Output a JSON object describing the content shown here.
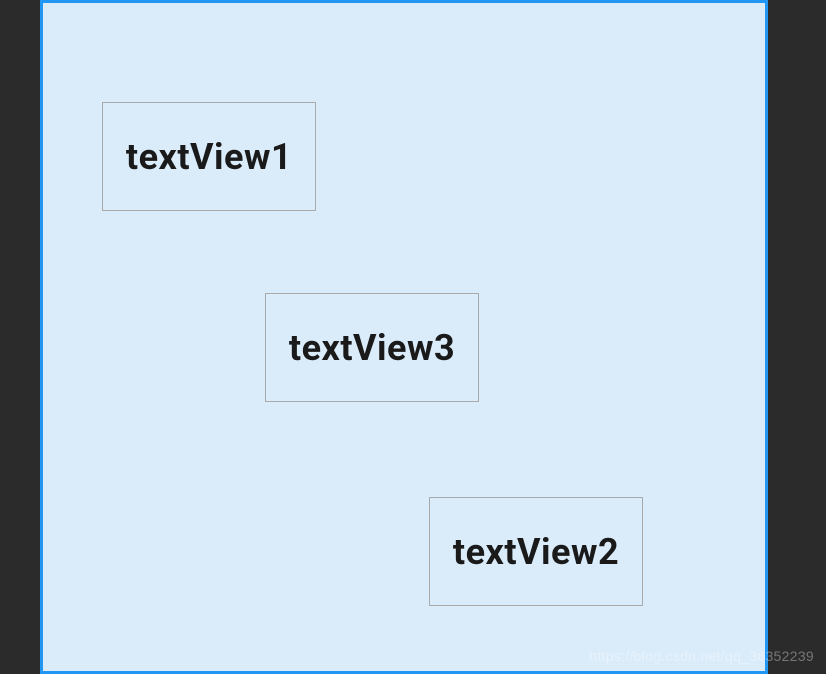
{
  "layout": {
    "views": {
      "textView1": {
        "label": "textView1"
      },
      "textView2": {
        "label": "textView2"
      },
      "textView3": {
        "label": "textView3"
      }
    }
  },
  "watermark": "https://blog.csdn.net/qq_36352239"
}
